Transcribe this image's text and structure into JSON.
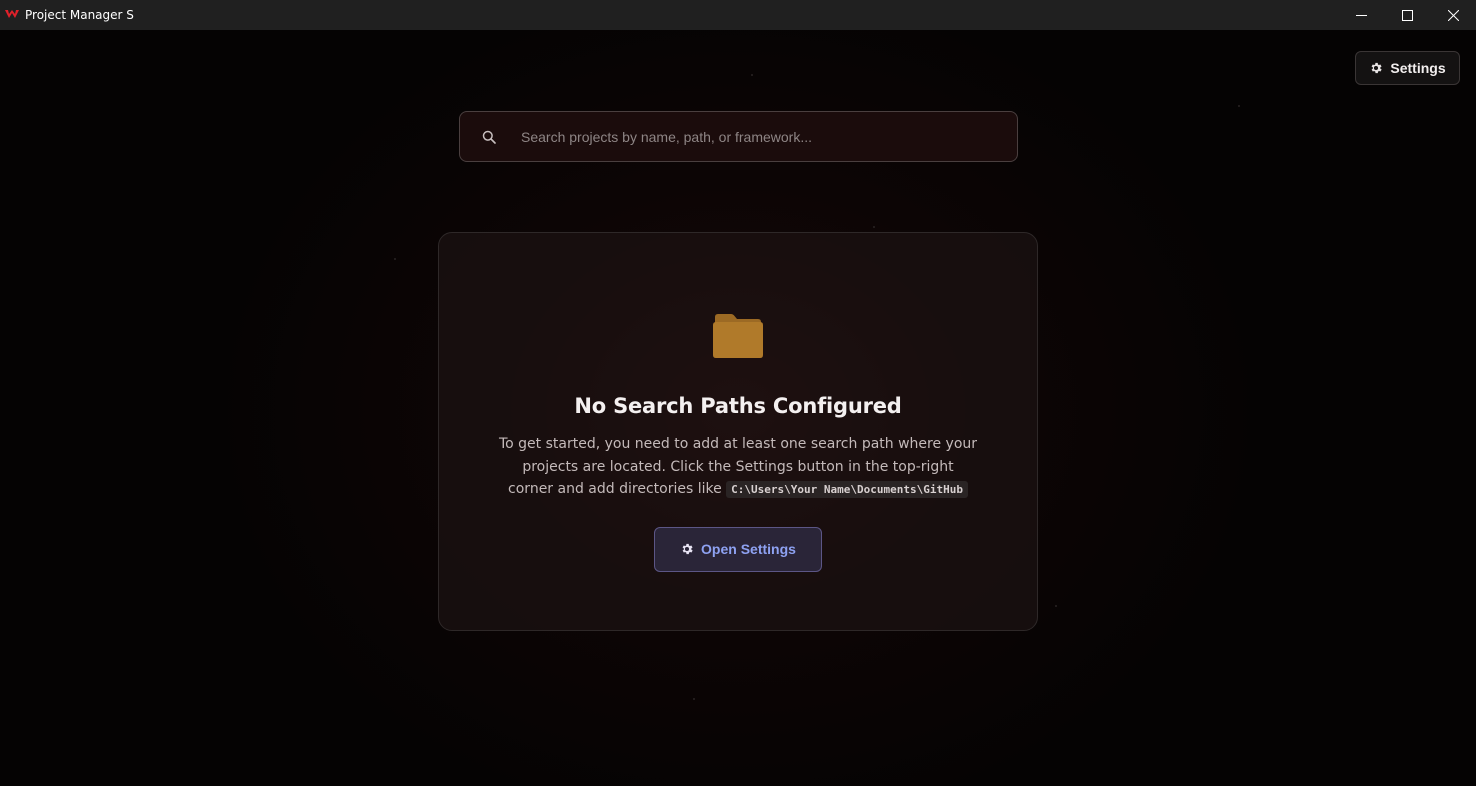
{
  "window": {
    "title": "Project Manager S"
  },
  "header": {
    "settings_label": "Settings",
    "settings_icon": "gear-icon"
  },
  "search": {
    "placeholder": "Search projects by name, path, or framework...",
    "value": "",
    "icon": "search-icon"
  },
  "empty_state": {
    "icon": "folder-icon",
    "title": "No Search Paths Configured",
    "description_prefix": "To get started, you need to add at least one search path where your projects are located. Click the Settings button in the top-right corner and add directories like",
    "example_path": "C:\\Users\\Your Name\\Documents\\GitHub",
    "button_label": "Open Settings"
  },
  "colors": {
    "background": "#050303",
    "accent_button_text": "#8ea2f2",
    "folder": "#b07a2a"
  }
}
